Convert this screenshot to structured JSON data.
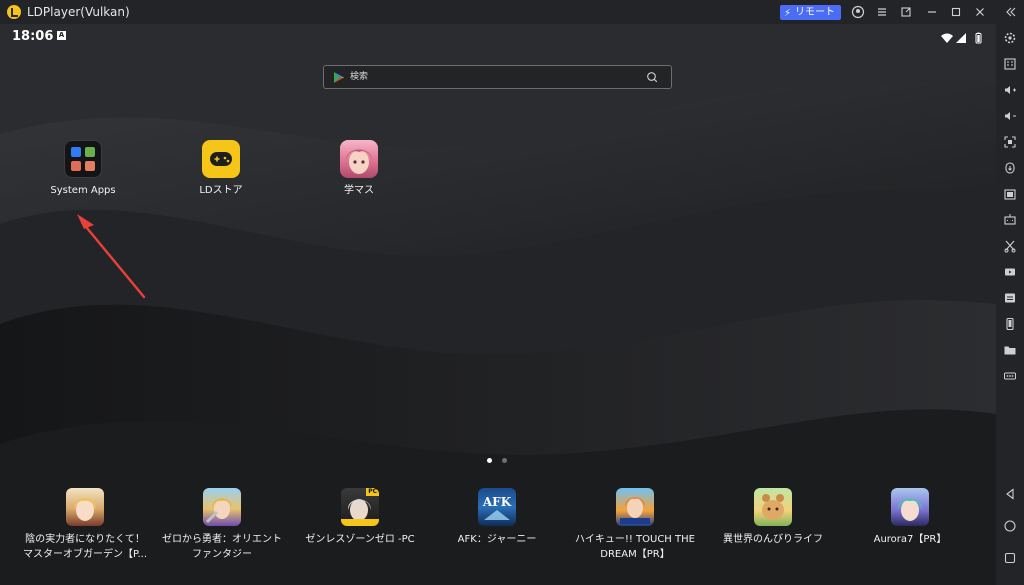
{
  "window": {
    "title": "LDPlayer(Vulkan)",
    "remote_label": "リモート"
  },
  "titlebar_icons": [
    "account-icon",
    "menu-icon",
    "popout-icon",
    "minimize-icon",
    "maximize-icon",
    "close-icon",
    "collapse-sidebar-icon"
  ],
  "status": {
    "time": "18:06",
    "notification_badge": "A"
  },
  "search": {
    "placeholder": "検索"
  },
  "home_apps": [
    {
      "label": "System Apps"
    },
    {
      "label": "LDストア"
    },
    {
      "label": "学マス"
    }
  ],
  "page_indicator": {
    "count": 2,
    "active": 0
  },
  "dock_apps": [
    {
      "label_line1": "陰の実力者になりたくて！",
      "label_line2": "マスターオブガーデン【P..."
    },
    {
      "label_line1": "ゼロから勇者：オリエント",
      "label_line2": "ファンタジー"
    },
    {
      "label_line1": "ゼンレスゾーンゼロ -PC",
      "label_line2": ""
    },
    {
      "label_line1": "AFK：ジャーニー",
      "label_line2": "",
      "icon_text": "AFK"
    },
    {
      "label_line1": "ハイキュー!! TOUCH THE",
      "label_line2": "DREAM【PR】"
    },
    {
      "label_line1": "異世界のんびりライフ",
      "label_line2": ""
    },
    {
      "label_line1": "Aurora7【PR】",
      "label_line2": ""
    }
  ],
  "zzz_badge": "PC",
  "sidebar_icons": [
    "settings-icon",
    "keyboard-mapping-icon",
    "volume-up-icon",
    "volume-down-icon",
    "screenshot-icon",
    "install-apk-icon",
    "multi-instance-icon",
    "operation-record-icon",
    "scissors-icon",
    "record-video-icon",
    "sync-icon",
    "rotate-icon",
    "folder-icon",
    "more-icon",
    "back-icon",
    "home-icon",
    "recents-icon"
  ],
  "colors": {
    "accent": "#4a6cf7",
    "arrow": "#e8413a",
    "ld_yellow": "#f5c518"
  }
}
